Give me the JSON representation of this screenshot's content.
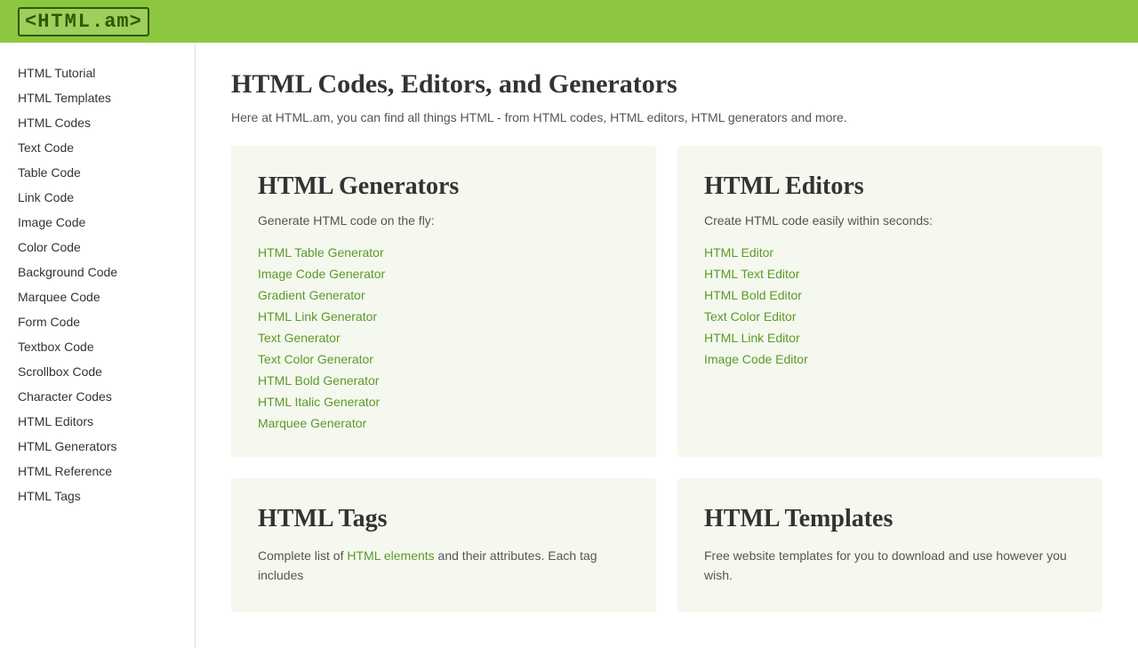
{
  "header": {
    "logo_prefix": "<HTML",
    "logo_suffix": ".am>"
  },
  "page": {
    "title": "HTML Codes, Editors, and Generators",
    "subtitle": "Here at HTML.am, you can find all things HTML - from HTML codes, HTML editors, HTML generators and more."
  },
  "sidebar": {
    "items": [
      {
        "label": "HTML Tutorial",
        "id": "html-tutorial"
      },
      {
        "label": "HTML Templates",
        "id": "html-templates"
      },
      {
        "label": "HTML Codes",
        "id": "html-codes"
      },
      {
        "label": "Text Code",
        "id": "text-code"
      },
      {
        "label": "Table Code",
        "id": "table-code"
      },
      {
        "label": "Link Code",
        "id": "link-code"
      },
      {
        "label": "Image Code",
        "id": "image-code"
      },
      {
        "label": "Color Code",
        "id": "color-code"
      },
      {
        "label": "Background Code",
        "id": "background-code"
      },
      {
        "label": "Marquee Code",
        "id": "marquee-code"
      },
      {
        "label": "Form Code",
        "id": "form-code"
      },
      {
        "label": "Textbox Code",
        "id": "textbox-code"
      },
      {
        "label": "Scrollbox Code",
        "id": "scrollbox-code"
      },
      {
        "label": "Character Codes",
        "id": "character-codes"
      },
      {
        "label": "HTML Editors",
        "id": "html-editors"
      },
      {
        "label": "HTML Generators",
        "id": "html-generators"
      },
      {
        "label": "HTML Reference",
        "id": "html-reference"
      },
      {
        "label": "HTML Tags",
        "id": "html-tags"
      }
    ]
  },
  "generators": {
    "title": "HTML Generators",
    "subtitle": "Generate HTML code on the fly:",
    "links": [
      {
        "label": "HTML Table Generator",
        "id": "html-table-generator"
      },
      {
        "label": "Image Code Generator",
        "id": "image-code-generator"
      },
      {
        "label": "Gradient Generator",
        "id": "gradient-generator"
      },
      {
        "label": "HTML Link Generator",
        "id": "html-link-generator"
      },
      {
        "label": "Text Generator",
        "id": "text-generator"
      },
      {
        "label": "Text Color Generator",
        "id": "text-color-generator"
      },
      {
        "label": "HTML Bold Generator",
        "id": "html-bold-generator"
      },
      {
        "label": "HTML Italic Generator",
        "id": "html-italic-generator"
      },
      {
        "label": "Marquee Generator",
        "id": "marquee-generator"
      }
    ]
  },
  "editors": {
    "title": "HTML Editors",
    "subtitle": "Create HTML code easily within seconds:",
    "links": [
      {
        "label": "HTML Editor",
        "id": "html-editor"
      },
      {
        "label": "HTML Text Editor",
        "id": "html-text-editor"
      },
      {
        "label": "HTML Bold Editor",
        "id": "html-bold-editor"
      },
      {
        "label": "Text Color Editor",
        "id": "text-color-editor"
      },
      {
        "label": "HTML Link Editor",
        "id": "html-link-editor"
      },
      {
        "label": "Image Code Editor",
        "id": "image-code-editor"
      }
    ]
  },
  "tags": {
    "title": "HTML Tags",
    "subtitle_text": "Complete list of ",
    "subtitle_link": "HTML elements",
    "subtitle_rest": " and their attributes. Each tag includes"
  },
  "templates": {
    "title": "HTML Templates",
    "subtitle": "Free website templates for you to download and use however you wish."
  }
}
